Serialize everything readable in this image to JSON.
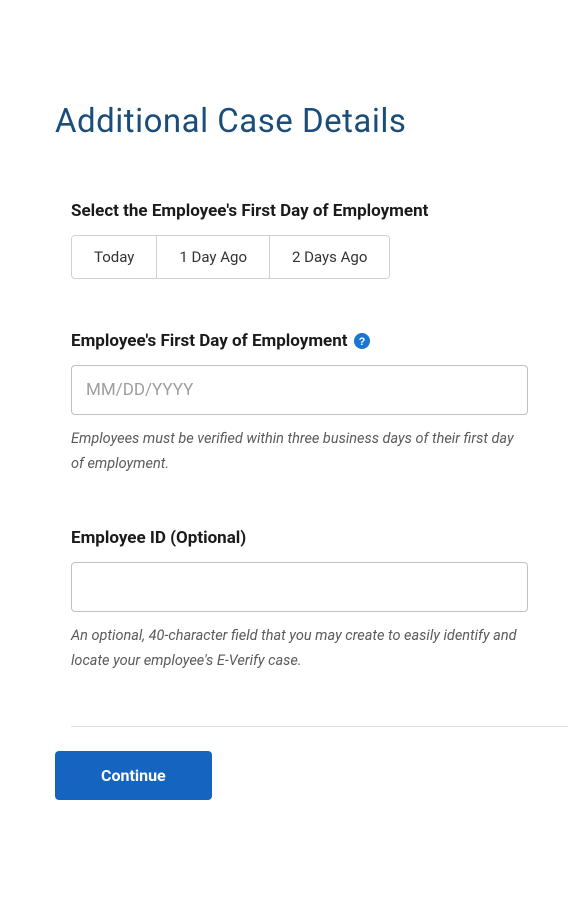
{
  "page": {
    "title": "Additional Case Details"
  },
  "firstDaySelect": {
    "label": "Select the Employee's First Day of Employment",
    "options": [
      "Today",
      "1 Day Ago",
      "2 Days Ago"
    ]
  },
  "firstDayField": {
    "label": "Employee's First Day of Employment",
    "placeholder": "MM/DD/YYYY",
    "value": "",
    "helper": "Employees must be verified within three business days of their first day of employment."
  },
  "employeeIdField": {
    "label": "Employee ID (Optional)",
    "value": "",
    "helper": "An optional, 40-character field that you may create to easily identify and locate your employee's E-Verify case."
  },
  "actions": {
    "continue": "Continue"
  }
}
